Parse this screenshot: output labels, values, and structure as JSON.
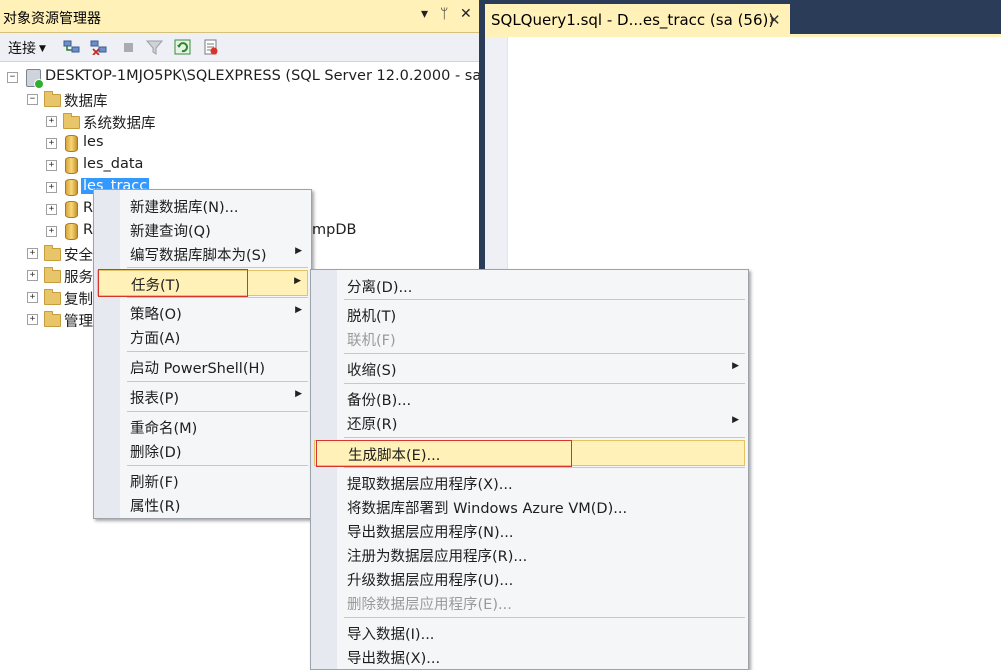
{
  "object_explorer": {
    "title": "对象资源管理器",
    "pin": "▾",
    "pin2": "ᛘ",
    "close": "✕",
    "toolbar": {
      "connect_label": "连接",
      "icons": [
        "connect-object-icon",
        "disconnect-icon",
        "stop-icon",
        "filter-icon",
        "refresh-icon",
        "summary-icon"
      ]
    },
    "tree": {
      "server": "DESKTOP-1MJO5PK\\SQLEXPRESS (SQL Server 12.0.2000 - sa",
      "databases": "数据库",
      "system_databases": "系统数据库",
      "db1": "les",
      "db2": "les_data",
      "db3": "les_tracc",
      "db4_partial": "R",
      "db5_partial": "R",
      "db5_tail": "mpDB",
      "security_partial": "安全",
      "server_objects_partial": "服务",
      "replication_partial": "复制",
      "management_partial": "管理"
    }
  },
  "document": {
    "tab_title": "SQLQuery1.sql - D...es_tracc (sa (56))",
    "tab_close": "✕"
  },
  "context_menu": {
    "items": [
      {
        "label": "新建数据库(N)..."
      },
      {
        "label": "新建查询(Q)"
      },
      {
        "label": "编写数据库脚本为(S)"
      },
      {
        "label": "任务(T)"
      },
      {
        "label": "策略(O)"
      },
      {
        "label": "方面(A)"
      },
      {
        "label": "启动 PowerShell(H)"
      },
      {
        "label": "报表(P)"
      },
      {
        "label": "重命名(M)"
      },
      {
        "label": "删除(D)"
      },
      {
        "label": "刷新(F)"
      },
      {
        "label": "属性(R)"
      }
    ]
  },
  "tasks_menu": {
    "items": [
      {
        "label": "分离(D)..."
      },
      {
        "label": "脱机(T)"
      },
      {
        "label": "联机(F)"
      },
      {
        "label": "收缩(S)"
      },
      {
        "label": "备份(B)..."
      },
      {
        "label": "还原(R)"
      },
      {
        "label": "生成脚本(E)..."
      },
      {
        "label": "提取数据层应用程序(X)..."
      },
      {
        "label": "将数据库部署到 Windows Azure VM(D)..."
      },
      {
        "label": "导出数据层应用程序(N)..."
      },
      {
        "label": "注册为数据层应用程序(R)..."
      },
      {
        "label": "升级数据层应用程序(U)..."
      },
      {
        "label": "删除数据层应用程序(E)..."
      },
      {
        "label": "导入数据(I)..."
      },
      {
        "label": "导出数据(X)..."
      }
    ]
  },
  "colors": {
    "highlight": "#fff1b8",
    "selection": "#3399ff",
    "annotation_red": "#d9342b",
    "background": "#2b3c59"
  }
}
